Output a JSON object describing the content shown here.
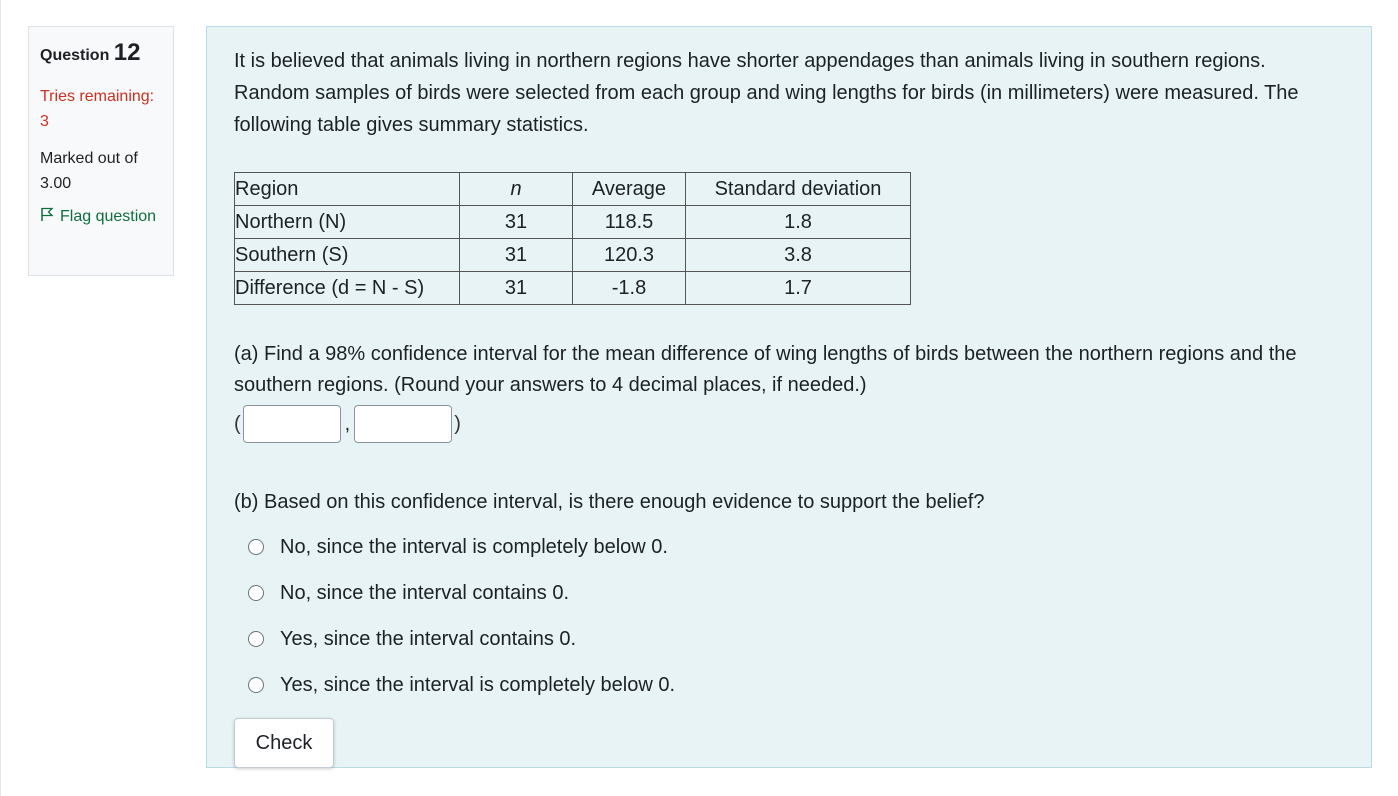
{
  "info": {
    "question_label": "Question",
    "question_number": "12",
    "state": "Tries remaining: 3",
    "grade": "Marked out of 3.00",
    "flag_label": "Flag question"
  },
  "question": {
    "paragraphs": [
      "It is believed that animals living in northern regions have shorter appendages than animals living in southern regions. Random samples of birds were selected from each group and wing lengths for birds (in millimeters) were measured. The following table gives summary statistics."
    ],
    "table": {
      "headers": [
        "Region",
        "n",
        "Average",
        "Standard deviation"
      ],
      "rows": [
        [
          "Northern (N)",
          "31",
          "118.5",
          "1.8"
        ],
        [
          "Southern (S)",
          "31",
          "120.3",
          "3.8"
        ],
        [
          "Difference (d = N - S)",
          "31",
          "-1.8",
          "1.7"
        ]
      ]
    },
    "part_a": "(a) Find a 98% confidence interval for the mean difference of wing lengths of birds between the northern regions and the southern regions. (Round your answers to 4 decimal places, if needed.)",
    "interval": {
      "open": "(",
      "comma": ",",
      "close": ")",
      "lower_value": "",
      "upper_value": ""
    },
    "part_b": "(b) Based on this confidence interval, is there enough evidence to support the belief?",
    "options": [
      "No, since the interval is completely below 0.",
      "No, since the interval contains 0.",
      "Yes, since the interval contains 0.",
      "Yes, since the interval is completely below 0."
    ],
    "check_label": "Check"
  },
  "colors": {
    "content_bg": "#e7f3f5",
    "state_red": "#ca3120",
    "flag_green": "#0f6e3e"
  }
}
